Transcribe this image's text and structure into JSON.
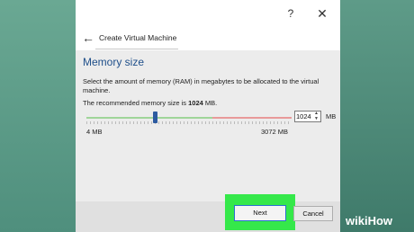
{
  "window": {
    "help_icon": "?",
    "close_icon": "✕"
  },
  "header": {
    "back_icon": "←",
    "title": "Create Virtual Machine"
  },
  "page": {
    "title": "Memory size",
    "description": "Select the amount of memory (RAM) in megabytes to be allocated to the virtual machine.",
    "recommended_prefix": "The recommended memory size is ",
    "recommended_value": "1024",
    "recommended_suffix": " MB."
  },
  "memory": {
    "value": "1024",
    "unit": "MB",
    "min_label": "4 MB",
    "max_label": "3072 MB",
    "slider_value": 1024,
    "slider_min": 4,
    "slider_max": 3072
  },
  "buttons": {
    "next": "Next",
    "cancel": "Cancel"
  },
  "watermark": {
    "wiki": "wiki",
    "how": "How"
  },
  "colors": {
    "highlight": "#35e84a",
    "title_blue": "#1f4f8a",
    "accent": "#2a6fd0"
  }
}
